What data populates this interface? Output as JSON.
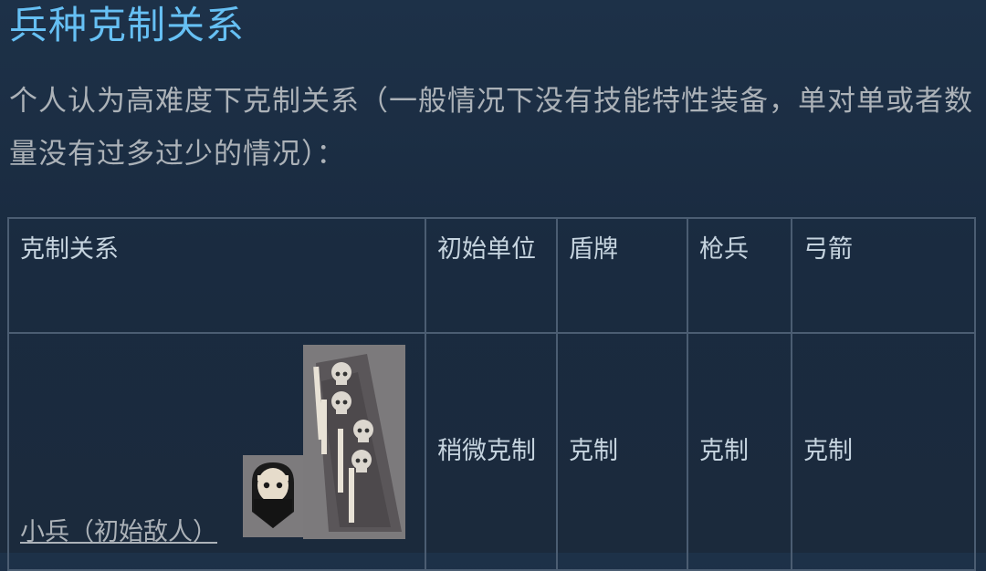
{
  "title": "兵种克制关系",
  "intro": "个人认为高难度下克制关系（一般情况下没有技能特性装备，单对单或者数量没有过多过少的情况）：",
  "table": {
    "headers": [
      "克制关系",
      "初始单位",
      "盾牌",
      "枪兵",
      "弓箭"
    ],
    "rows": [
      {
        "unit": "小兵（初始敌人）",
        "cells": [
          "稍微克制",
          "克制",
          "克制",
          "克制"
        ]
      }
    ]
  },
  "icons": {
    "small_portrait": "hooded-soldier-portrait-icon",
    "big_portrait": "skull-spearmen-banner-icon"
  },
  "colors": {
    "title": "#66c0f4",
    "text": "#acb2b8",
    "border": "#4b5d72"
  }
}
